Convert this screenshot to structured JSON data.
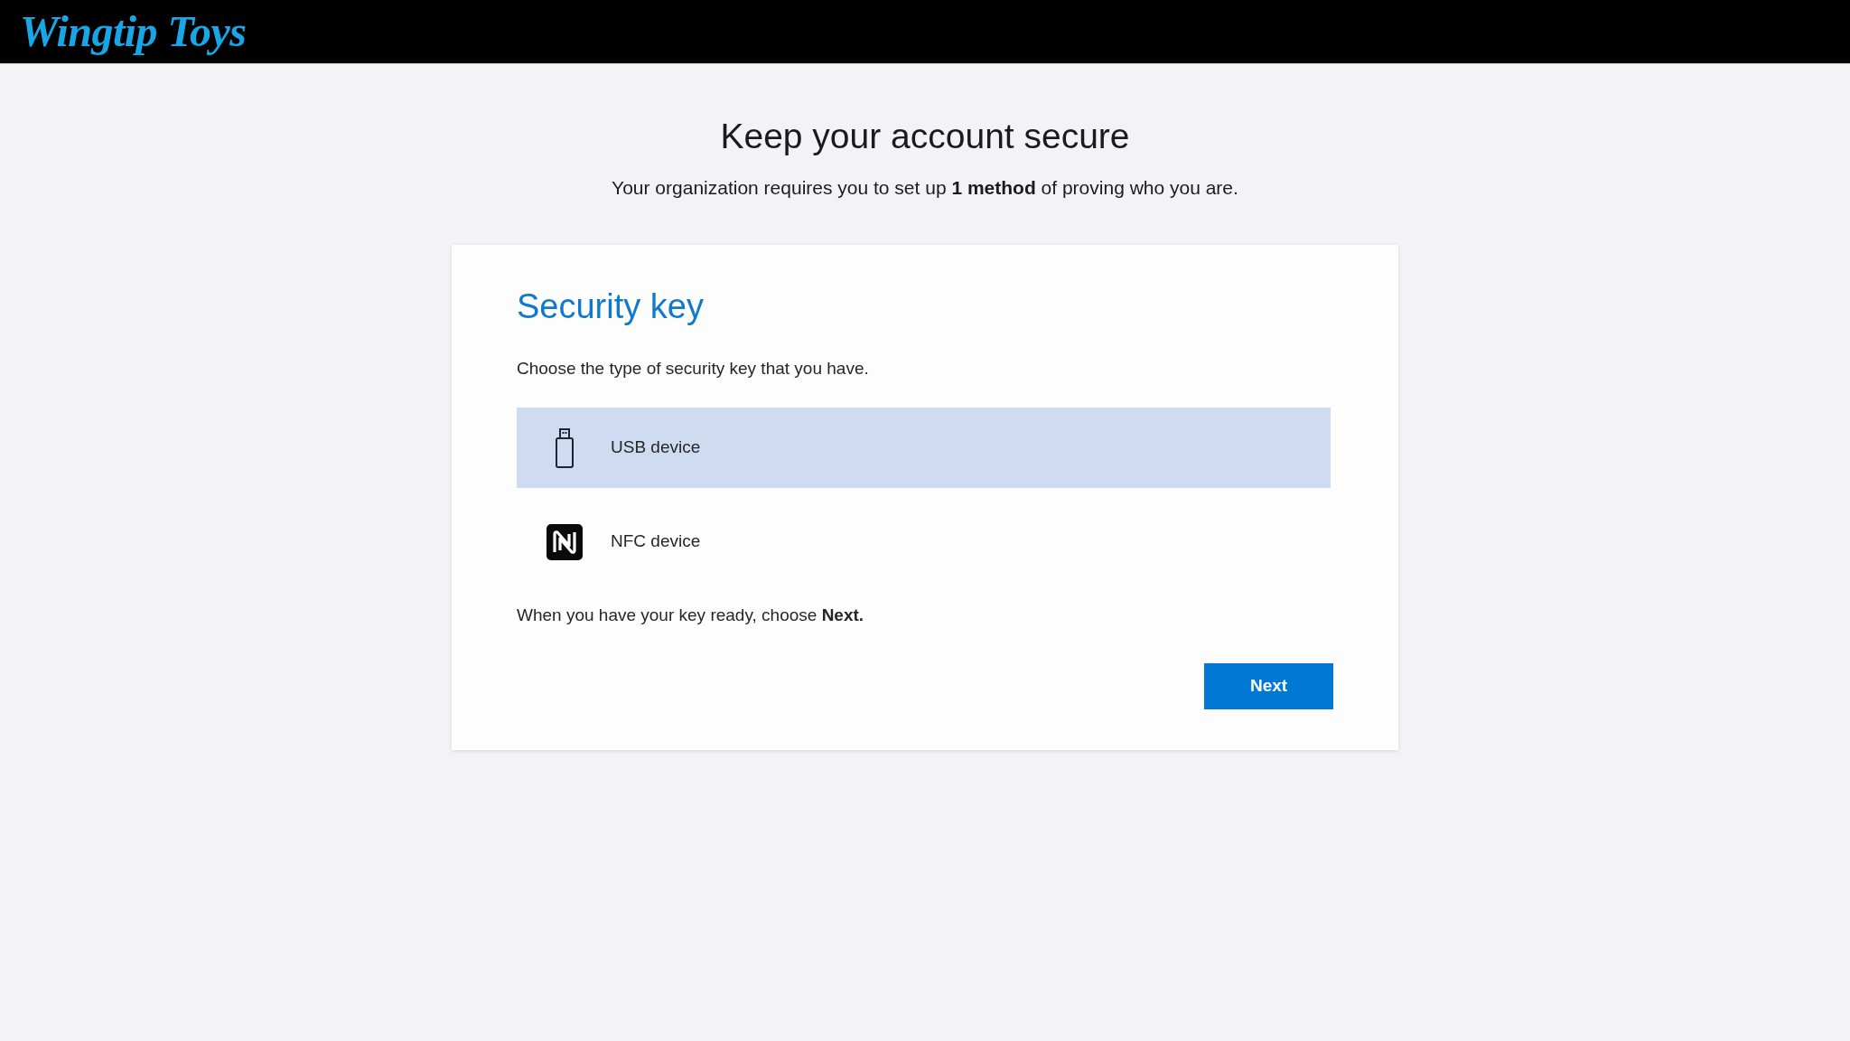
{
  "header": {
    "logo": "Wingtip Toys"
  },
  "page": {
    "title": "Keep your account secure",
    "subtitle": "Your organization requires you to set up **1 method** of proving who you are."
  },
  "card": {
    "title": "Security key",
    "prompt": "Choose the type of security key that you have.",
    "options": [
      {
        "kind": "usb",
        "label": "USB device",
        "selected": true
      },
      {
        "kind": "nfc",
        "label": "NFC device",
        "selected": false
      }
    ],
    "instruction": "When you have your key ready, choose **Next.**",
    "button": "Next"
  }
}
